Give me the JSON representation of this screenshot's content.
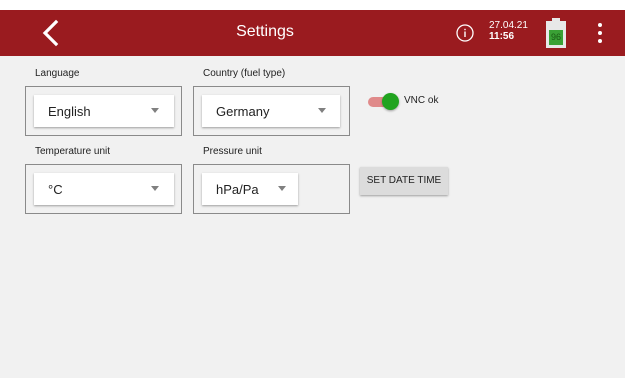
{
  "header": {
    "title": "Settings",
    "date": "27.04.21",
    "time": "11:56",
    "battery_level_text": "96",
    "accent_color": "#9a1b1f",
    "icons": [
      "back-icon",
      "info-icon",
      "battery-icon",
      "more-vert-icon"
    ]
  },
  "settings": {
    "language": {
      "label": "Language",
      "value": "English"
    },
    "country": {
      "label": "Country (fuel type)",
      "value": "Germany"
    },
    "temperature": {
      "label": "Temperature unit",
      "value": "°C"
    },
    "pressure": {
      "label": "Pressure unit",
      "value": "hPa/Pa"
    }
  },
  "vnc": {
    "label": "VNC ok",
    "enabled": true
  },
  "set_date_time_button": "SET DATE TIME"
}
